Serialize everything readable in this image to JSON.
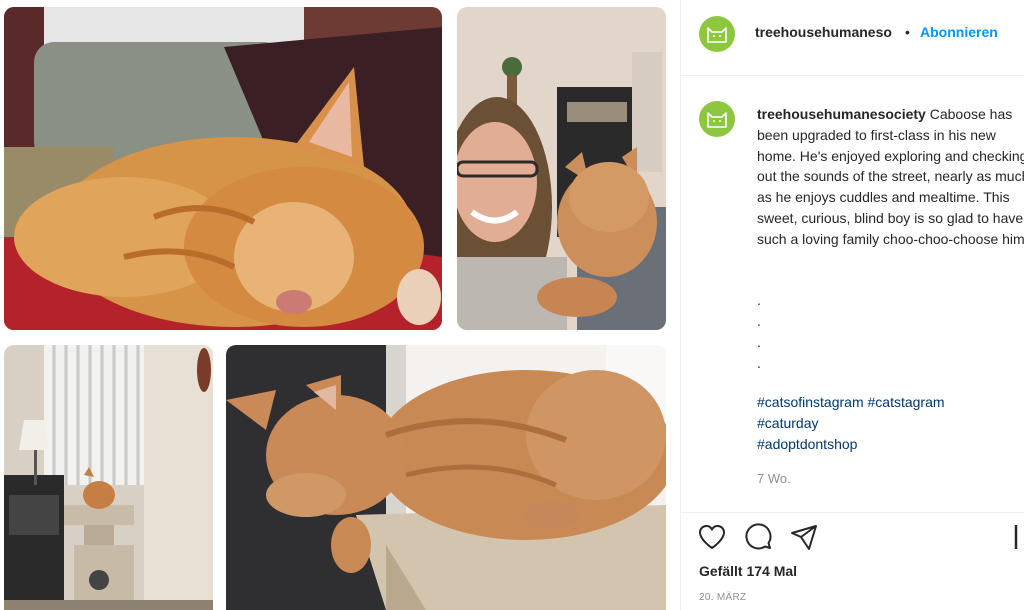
{
  "post": {
    "username_short": "treehousehumaneso",
    "username_full": "treehousehumanesociety",
    "follow_label": "Abonnieren",
    "dot": "•",
    "caption_text": "Caboose has been upgraded to first-class in his new home. He's enjoyed exploring and checking out the sounds of the street, nearly as much as he enjoys cuddles and mealtime. This sweet, curious, blind boy is so glad to have such a loving family choo-choo-choose him!",
    "dots": [
      ".",
      ".",
      ".",
      "."
    ],
    "hashtags": [
      "#catsofinstagram",
      "#catstagram",
      "#caturday",
      "#adoptdontshop"
    ],
    "relative_time": "7 Wo.",
    "likes_text": "Gefällt 174 Mal",
    "date_text": "20. MÄRZ"
  },
  "icons": {
    "avatar": "cat-logo-icon",
    "like": "heart-icon",
    "comment": "comment-bubble-icon",
    "share": "paper-plane-icon",
    "save": "bookmark-icon"
  },
  "colors": {
    "avatar_bg": "#8dc63f",
    "follow": "#0095f6",
    "hashtag": "#00376b",
    "muted": "#8e8e8e",
    "text": "#262626"
  }
}
